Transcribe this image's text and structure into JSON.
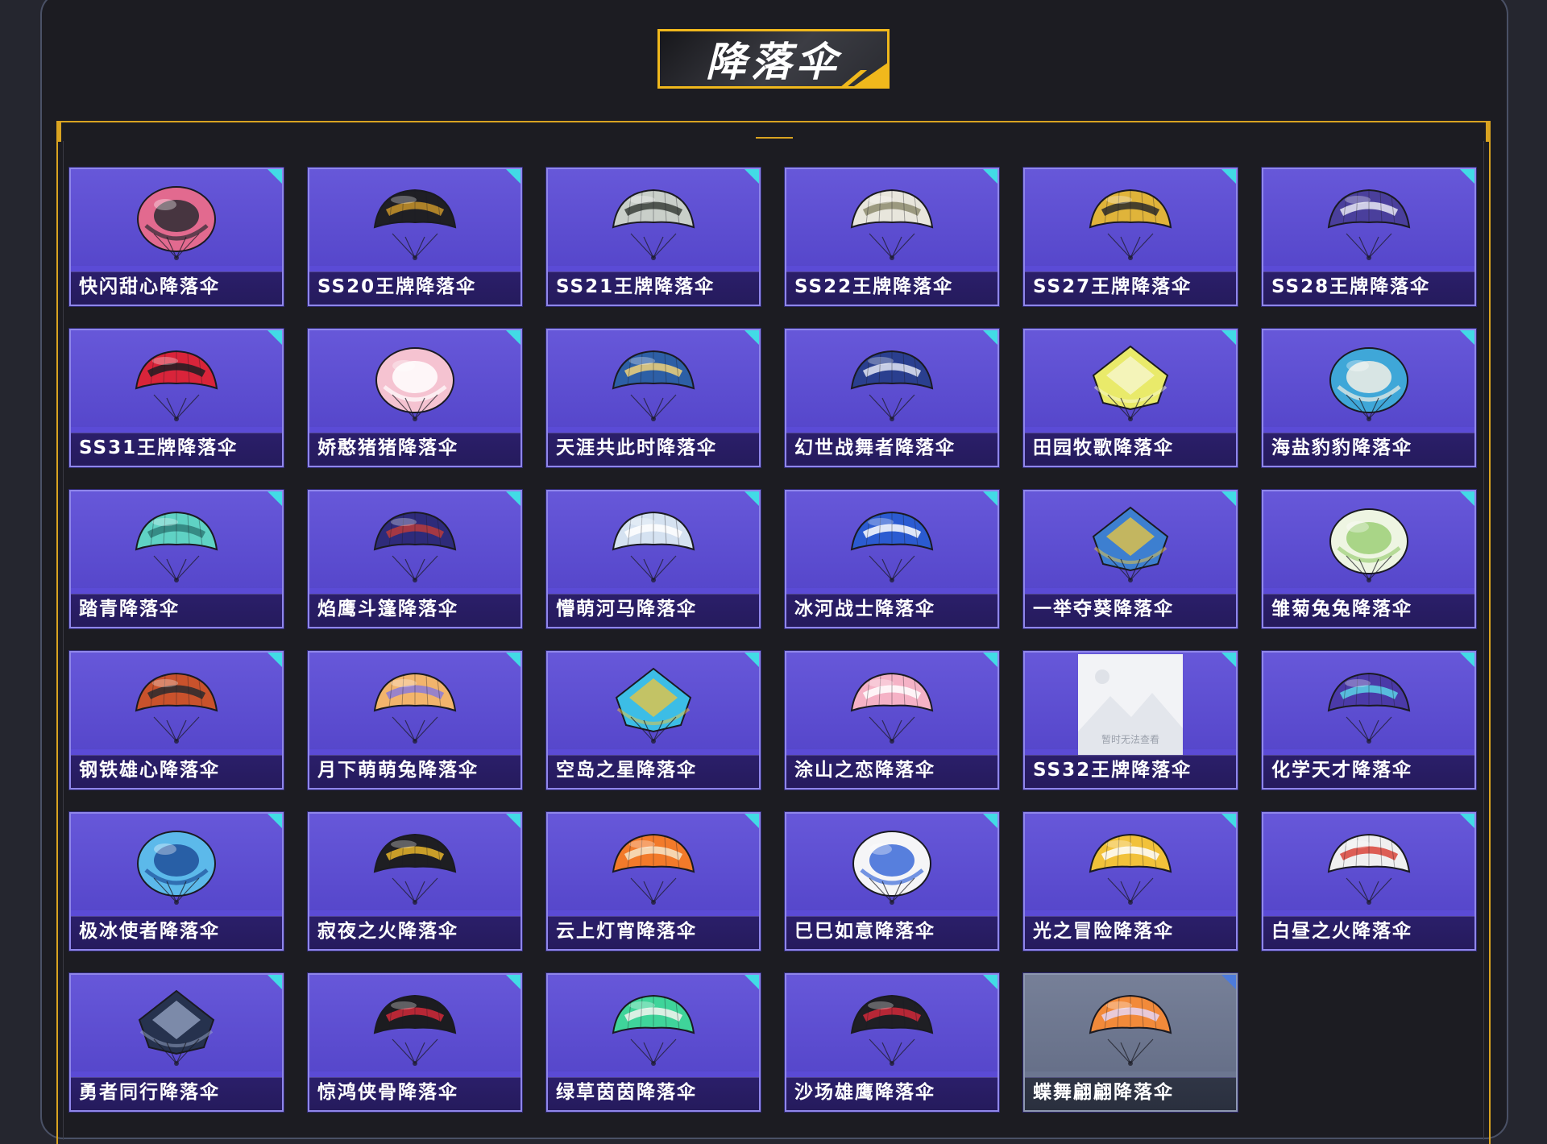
{
  "section": {
    "title": "降落伞"
  },
  "items": [
    {
      "label": "快闪甜心降落伞",
      "colors": [
        "#e26a8f",
        "#2b2b32"
      ],
      "shape": "round"
    },
    {
      "label": "SS20王牌降落伞",
      "colors": [
        "#1f1f24",
        "#c8942a"
      ],
      "shape": "wing"
    },
    {
      "label": "SS21王牌降落伞",
      "colors": [
        "#c9cfc9",
        "#3a3f3a"
      ],
      "shape": "wing"
    },
    {
      "label": "SS22王牌降落伞",
      "colors": [
        "#e8e6dc",
        "#8d8b6e"
      ],
      "shape": "wing"
    },
    {
      "label": "SS27王牌降落伞",
      "colors": [
        "#e0b43a",
        "#2a2a2a"
      ],
      "shape": "wing"
    },
    {
      "label": "SS28王牌降落伞",
      "colors": [
        "#4a3f9c",
        "#e8e8f4"
      ],
      "shape": "wing"
    },
    {
      "label": "SS31王牌降落伞",
      "colors": [
        "#d9243a",
        "#1d1d22"
      ],
      "shape": "wing"
    },
    {
      "label": "娇憨猪猪降落伞",
      "colors": [
        "#f5c3d1",
        "#ffffff"
      ],
      "shape": "round"
    },
    {
      "label": "天涯共此时降落伞",
      "colors": [
        "#2d5fa6",
        "#f1d27a"
      ],
      "shape": "wing"
    },
    {
      "label": "幻世战舞者降落伞",
      "colors": [
        "#2a3f8f",
        "#e3e6f4"
      ],
      "shape": "wing"
    },
    {
      "label": "田园牧歌降落伞",
      "colors": [
        "#e9ea6a",
        "#f7f7d4"
      ],
      "shape": "square"
    },
    {
      "label": "海盐豹豹降落伞",
      "colors": [
        "#3fa7d8",
        "#f3f0e6"
      ],
      "shape": "round"
    },
    {
      "label": "踏青降落伞",
      "colors": [
        "#5fd2c4",
        "#2f7f7a"
      ],
      "shape": "wing"
    },
    {
      "label": "焰鹰斗篷降落伞",
      "colors": [
        "#2e2b7a",
        "#b83b3b"
      ],
      "shape": "wing"
    },
    {
      "label": "懵萌河马降落伞",
      "colors": [
        "#d5e2f1",
        "#ffffff"
      ],
      "shape": "wing"
    },
    {
      "label": "冰河战士降落伞",
      "colors": [
        "#2b5bd1",
        "#ffffff"
      ],
      "shape": "wing"
    },
    {
      "label": "一举夺葵降落伞",
      "colors": [
        "#3d7fd0",
        "#f0c83b"
      ],
      "shape": "square"
    },
    {
      "label": "雏菊兔兔降落伞",
      "colors": [
        "#eef5e2",
        "#9ccf77"
      ],
      "shape": "round"
    },
    {
      "label": "钢铁雄心降落伞",
      "colors": [
        "#c9522c",
        "#2a2a2e"
      ],
      "shape": "wing"
    },
    {
      "label": "月下萌萌兔降落伞",
      "colors": [
        "#f2b46c",
        "#8a7ad9"
      ],
      "shape": "wing"
    },
    {
      "label": "空岛之星降落伞",
      "colors": [
        "#3cbde6",
        "#f0c63a"
      ],
      "shape": "square"
    },
    {
      "label": "涂山之恋降落伞",
      "colors": [
        "#f5b2c6",
        "#ffffff"
      ],
      "shape": "wing"
    },
    {
      "label": "SS32王牌降落伞",
      "colors": [
        "#f2f3f6",
        "#c9ced8"
      ],
      "shape": "placeholder",
      "placeholder_text": "暂时无法查看"
    },
    {
      "label": "化学天才降落伞",
      "colors": [
        "#4b3aa8",
        "#5ad3e6"
      ],
      "shape": "wing"
    },
    {
      "label": "极冰使者降落伞",
      "colors": [
        "#5cb9ea",
        "#1e4f9a"
      ],
      "shape": "round"
    },
    {
      "label": "寂夜之火降落伞",
      "colors": [
        "#1e1e22",
        "#e8b52a"
      ],
      "shape": "wing"
    },
    {
      "label": "云上灯宵降落伞",
      "colors": [
        "#f27a2a",
        "#f7e6c8"
      ],
      "shape": "wing"
    },
    {
      "label": "巳巳如意降落伞",
      "colors": [
        "#f5f5f7",
        "#3b6ad8"
      ],
      "shape": "round"
    },
    {
      "label": "光之冒险降落伞",
      "colors": [
        "#f2c23a",
        "#ffffff"
      ],
      "shape": "wing"
    },
    {
      "label": "白昼之火降落伞",
      "colors": [
        "#f0f0f0",
        "#d9443a"
      ],
      "shape": "wing"
    },
    {
      "label": "勇者同行降落伞",
      "colors": [
        "#26324e",
        "#9aa8c8"
      ],
      "shape": "square"
    },
    {
      "label": "惊鸿侠骨降落伞",
      "colors": [
        "#1c1c20",
        "#d2293a"
      ],
      "shape": "wing"
    },
    {
      "label": "绿草茵茵降落伞",
      "colors": [
        "#3fd49a",
        "#f5f5f0"
      ],
      "shape": "wing"
    },
    {
      "label": "沙场雄鹰降落伞",
      "colors": [
        "#1f1f24",
        "#d2293a"
      ],
      "shape": "wing"
    },
    {
      "label": "蝶舞翩翩降落伞",
      "colors": [
        "#f28a3a",
        "#e8d5f5"
      ],
      "shape": "wing",
      "alt": true
    }
  ],
  "theme": {
    "accent": "#f0b81c",
    "card_bg": "#5b4bd6",
    "corner_tag": "#42dbe6"
  }
}
